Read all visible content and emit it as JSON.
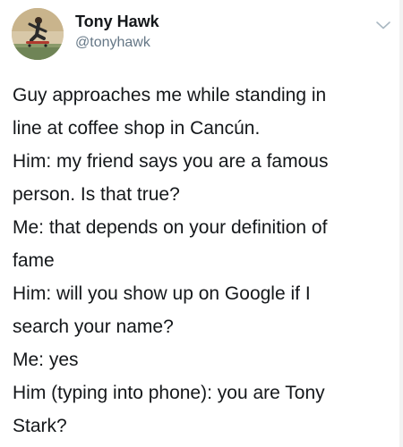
{
  "tweet": {
    "author": {
      "display_name": "Tony Hawk",
      "handle": "@tonyhawk",
      "avatar_icon": "profile-photo-skateboarder"
    },
    "menu_icon": "chevron-down-icon",
    "text_lines": [
      "Guy approaches me while standing in",
      "line at coffee shop in Cancún.",
      "Him: my friend says you are a famous",
      "person. Is that true?",
      "Me: that depends on your definition of",
      "fame",
      "Him: will you show up on Google if I",
      "search your name?",
      "Me: yes",
      "Him (typing into phone): you are Tony",
      "Stark?"
    ]
  },
  "colors": {
    "text": "#14171a",
    "secondary_text": "#657786",
    "chevron": "#aab8c2",
    "background": "#ffffff"
  }
}
